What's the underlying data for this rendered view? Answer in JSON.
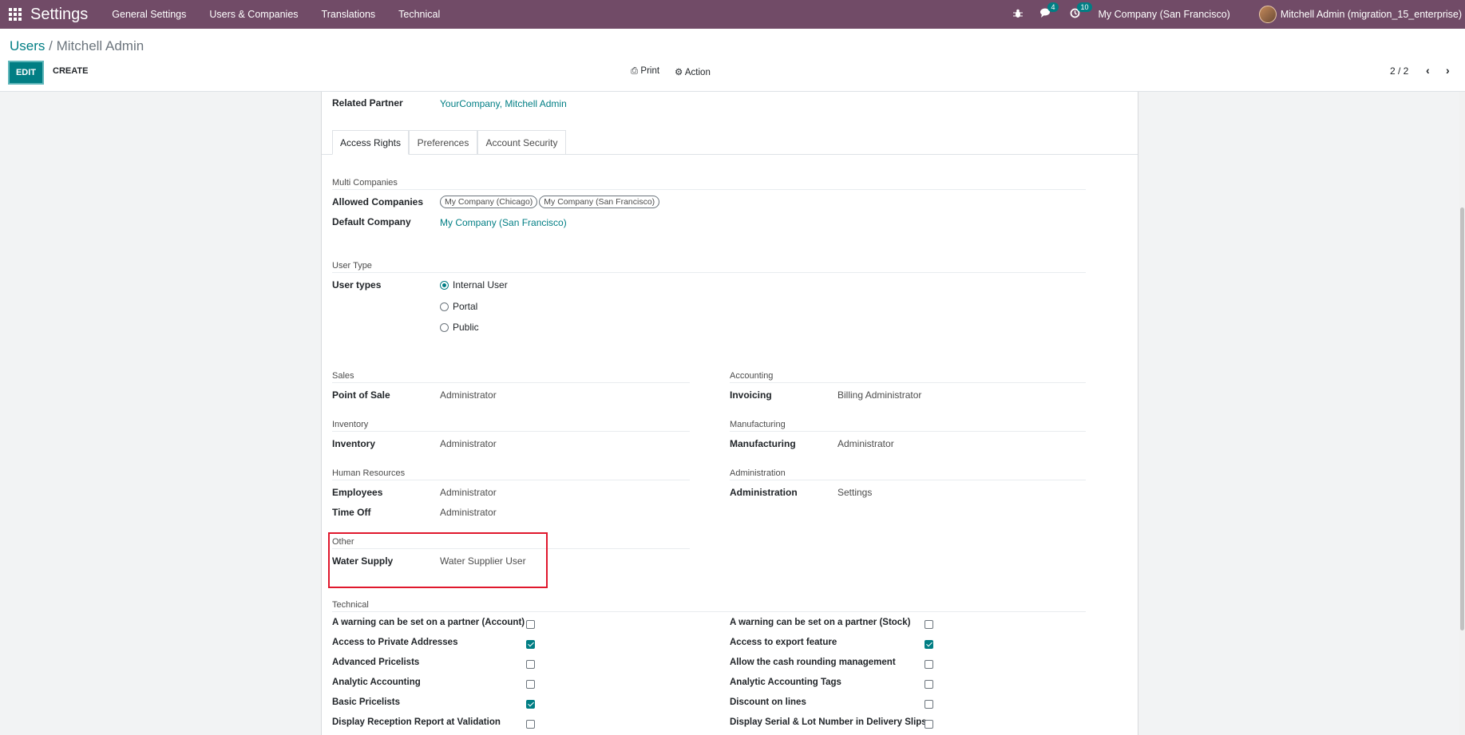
{
  "navbar": {
    "brand": "Settings",
    "menu": [
      "General Settings",
      "Users & Companies",
      "Translations",
      "Technical"
    ],
    "messages_badge": "4",
    "activities_badge": "10",
    "company": "My Company (San Francisco)",
    "user": "Mitchell Admin (migration_15_enterprise)"
  },
  "breadcrumb": {
    "parent": "Users",
    "sep": " / ",
    "current": "Mitchell Admin"
  },
  "toolbar": {
    "edit": "EDIT",
    "create": "CREATE",
    "print": "Print",
    "action": "Action"
  },
  "pager": {
    "text": "2 / 2",
    "prev": "‹",
    "next": "›"
  },
  "form": {
    "related_partner_label": "Related Partner",
    "related_partner_value": "YourCompany, Mitchell Admin",
    "tabs": [
      "Access Rights",
      "Preferences",
      "Account Security"
    ],
    "multi_companies": {
      "title": "Multi Companies",
      "allowed_label": "Allowed Companies",
      "allowed": [
        "My Company (Chicago)",
        "My Company (San Francisco)"
      ],
      "default_label": "Default Company",
      "default_value": "My Company (San Francisco)"
    },
    "user_type": {
      "title": "User Type",
      "label": "User types",
      "options": [
        "Internal User",
        "Portal",
        "Public"
      ],
      "selected": "Internal User"
    },
    "groups_left": [
      {
        "title": "Sales",
        "rows": [
          {
            "label": "Point of Sale",
            "value": "Administrator"
          }
        ]
      },
      {
        "title": "Inventory",
        "rows": [
          {
            "label": "Inventory",
            "value": "Administrator"
          }
        ]
      },
      {
        "title": "Human Resources",
        "rows": [
          {
            "label": "Employees",
            "value": "Administrator"
          },
          {
            "label": "Time Off",
            "value": "Administrator"
          }
        ]
      },
      {
        "title": "Other",
        "rows": [
          {
            "label": "Water Supply",
            "value": "Water Supplier User"
          }
        ]
      }
    ],
    "groups_right": [
      {
        "title": "Accounting",
        "rows": [
          {
            "label": "Invoicing",
            "value": "Billing Administrator"
          }
        ]
      },
      {
        "title": "Manufacturing",
        "rows": [
          {
            "label": "Manufacturing",
            "value": "Administrator"
          }
        ]
      },
      {
        "title": "Administration",
        "rows": [
          {
            "label": "Administration",
            "value": "Settings"
          }
        ]
      }
    ],
    "technical": {
      "title": "Technical",
      "left": [
        {
          "label": "A warning can be set on a partner (Account)",
          "checked": false
        },
        {
          "label": "Access to Private Addresses",
          "checked": true
        },
        {
          "label": "Advanced Pricelists",
          "checked": false
        },
        {
          "label": "Analytic Accounting",
          "checked": false
        },
        {
          "label": "Basic Pricelists",
          "checked": true
        },
        {
          "label": "Display Reception Report at Validation",
          "checked": false
        }
      ],
      "right": [
        {
          "label": "A warning can be set on a partner (Stock)",
          "checked": false
        },
        {
          "label": "Access to export feature",
          "checked": true
        },
        {
          "label": "Allow the cash rounding management",
          "checked": false
        },
        {
          "label": "Analytic Accounting Tags",
          "checked": false
        },
        {
          "label": "Discount on lines",
          "checked": false
        },
        {
          "label": "Display Serial & Lot Number in Delivery Slips",
          "checked": false
        }
      ]
    }
  },
  "colors": {
    "navbar": "#714b67",
    "primary": "#017e84",
    "highlight": "#e0182d"
  }
}
